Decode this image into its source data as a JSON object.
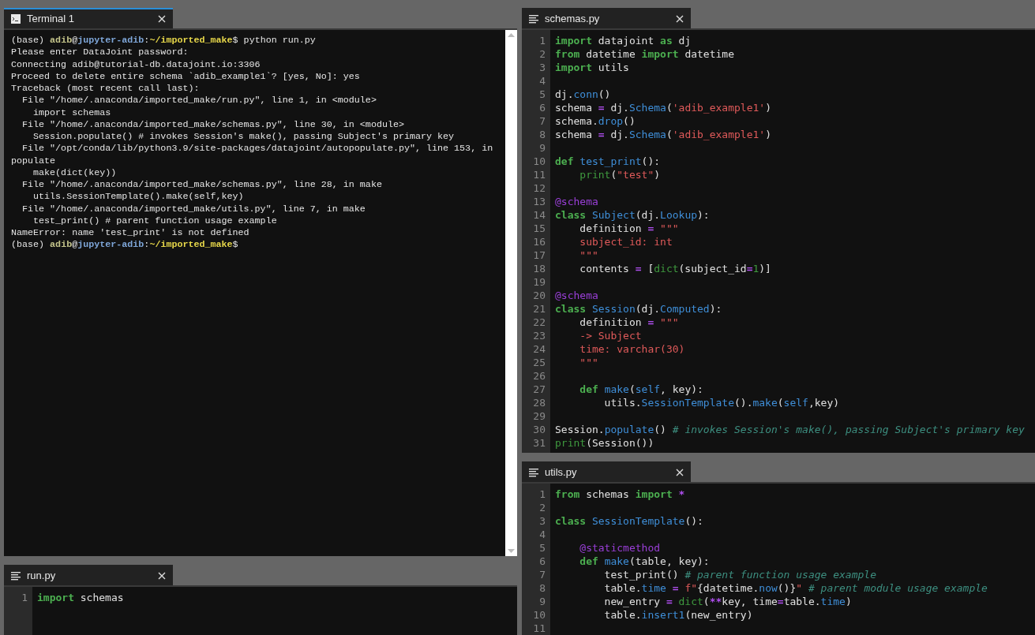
{
  "left": [
    {
      "kind": "terminal",
      "tab": {
        "label": "Terminal 1",
        "selected": true
      },
      "lines": [
        [
          {
            "kind": "plain",
            "text": "(base) "
          },
          {
            "kind": "user",
            "text": "adib"
          },
          {
            "kind": "plain",
            "text": "@"
          },
          {
            "kind": "host",
            "text": "jupyter-adib"
          },
          {
            "kind": "plain",
            "text": ":"
          },
          {
            "kind": "path",
            "text": "~/imported_make"
          },
          {
            "kind": "plain",
            "text": "$ python run.py"
          }
        ],
        [
          {
            "kind": "plain",
            "text": "Please enter DataJoint password:"
          }
        ],
        [
          {
            "kind": "plain",
            "text": "Connecting adib@tutorial-db.datajoint.io:3306"
          }
        ],
        [
          {
            "kind": "plain",
            "text": "Proceed to delete entire schema `adib_example1`? [yes, No]: yes"
          }
        ],
        [
          {
            "kind": "plain",
            "text": "Traceback (most recent call last):"
          }
        ],
        [
          {
            "kind": "plain",
            "text": "  File \"/home/.anaconda/imported_make/run.py\", line 1, in <module>"
          }
        ],
        [
          {
            "kind": "plain",
            "text": "    import schemas"
          }
        ],
        [
          {
            "kind": "plain",
            "text": "  File \"/home/.anaconda/imported_make/schemas.py\", line 30, in <module>"
          }
        ],
        [
          {
            "kind": "plain",
            "text": "    Session.populate() # invokes Session's make(), passing Subject's primary key"
          }
        ],
        [
          {
            "kind": "plain",
            "text": "  File \"/opt/conda/lib/python3.9/site-packages/datajoint/autopopulate.py\", line 153, in"
          }
        ],
        [
          {
            "kind": "plain",
            "text": "populate"
          }
        ],
        [
          {
            "kind": "plain",
            "text": "    make(dict(key))"
          }
        ],
        [
          {
            "kind": "plain",
            "text": "  File \"/home/.anaconda/imported_make/schemas.py\", line 28, in make"
          }
        ],
        [
          {
            "kind": "plain",
            "text": "    utils.SessionTemplate().make(self,key)"
          }
        ],
        [
          {
            "kind": "plain",
            "text": "  File \"/home/.anaconda/imported_make/utils.py\", line 7, in make"
          }
        ],
        [
          {
            "kind": "plain",
            "text": "    test_print() # parent function usage example"
          }
        ],
        [
          {
            "kind": "plain",
            "text": "NameError: name 'test_print' is not defined"
          }
        ],
        [
          {
            "kind": "plain",
            "text": "(base) "
          },
          {
            "kind": "user",
            "text": "adib"
          },
          {
            "kind": "plain",
            "text": "@"
          },
          {
            "kind": "host",
            "text": "jupyter-adib"
          },
          {
            "kind": "plain",
            "text": ":"
          },
          {
            "kind": "path",
            "text": "~/imported_make"
          },
          {
            "kind": "plain",
            "text": "$"
          }
        ]
      ]
    },
    {
      "kind": "editor",
      "tab": {
        "label": "run.py",
        "selected": false
      },
      "lines": [
        {
          "number": "1",
          "tokens": [
            {
              "kind": "kw",
              "text": "import"
            },
            {
              "kind": "plain",
              "text": " schemas"
            }
          ]
        }
      ]
    }
  ],
  "right": [
    {
      "kind": "editor",
      "tab": {
        "label": "schemas.py",
        "selected": false
      },
      "lines": [
        {
          "number": "1",
          "tokens": [
            {
              "kind": "kw",
              "text": "import"
            },
            {
              "kind": "plain",
              "text": " datajoint "
            },
            {
              "kind": "kw",
              "text": "as"
            },
            {
              "kind": "plain",
              "text": " dj"
            }
          ]
        },
        {
          "number": "2",
          "tokens": [
            {
              "kind": "kw",
              "text": "from"
            },
            {
              "kind": "plain",
              "text": " datetime "
            },
            {
              "kind": "kw",
              "text": "import"
            },
            {
              "kind": "plain",
              "text": " datetime"
            }
          ]
        },
        {
          "number": "3",
          "tokens": [
            {
              "kind": "kw",
              "text": "import"
            },
            {
              "kind": "plain",
              "text": " utils"
            }
          ]
        },
        {
          "number": "4"
        },
        {
          "number": "5",
          "tokens": [
            {
              "kind": "plain",
              "text": "dj."
            },
            {
              "kind": "fn",
              "text": "conn"
            },
            {
              "kind": "plain",
              "text": "()"
            }
          ]
        },
        {
          "number": "6",
          "tokens": [
            {
              "kind": "plain",
              "text": "schema "
            },
            {
              "kind": "op",
              "text": "="
            },
            {
              "kind": "plain",
              "text": " dj."
            },
            {
              "kind": "fn",
              "text": "Schema"
            },
            {
              "kind": "plain",
              "text": "("
            },
            {
              "kind": "str",
              "text": "'adib_example1'"
            },
            {
              "kind": "plain",
              "text": ")"
            }
          ]
        },
        {
          "number": "7",
          "tokens": [
            {
              "kind": "plain",
              "text": "schema."
            },
            {
              "kind": "fn",
              "text": "drop"
            },
            {
              "kind": "plain",
              "text": "()"
            }
          ]
        },
        {
          "number": "8",
          "tokens": [
            {
              "kind": "plain",
              "text": "schema "
            },
            {
              "kind": "op",
              "text": "="
            },
            {
              "kind": "plain",
              "text": " dj."
            },
            {
              "kind": "fn",
              "text": "Schema"
            },
            {
              "kind": "plain",
              "text": "("
            },
            {
              "kind": "str",
              "text": "'adib_example1'"
            },
            {
              "kind": "plain",
              "text": ")"
            }
          ]
        },
        {
          "number": "9"
        },
        {
          "number": "10",
          "tokens": [
            {
              "kind": "kw",
              "text": "def "
            },
            {
              "kind": "fn",
              "text": "test_print"
            },
            {
              "kind": "plain",
              "text": "():"
            }
          ]
        },
        {
          "number": "11",
          "tokens": [
            {
              "kind": "bi",
              "text": "    print"
            },
            {
              "kind": "plain",
              "text": "("
            },
            {
              "kind": "str",
              "text": "\"test\""
            },
            {
              "kind": "plain",
              "text": ")"
            }
          ]
        },
        {
          "number": "12"
        },
        {
          "number": "13",
          "tokens": [
            {
              "kind": "deco",
              "text": "@schema"
            }
          ]
        },
        {
          "number": "14",
          "tokens": [
            {
              "kind": "kw",
              "text": "class "
            },
            {
              "kind": "fn",
              "text": "Subject"
            },
            {
              "kind": "plain",
              "text": "(dj."
            },
            {
              "kind": "fn",
              "text": "Lookup"
            },
            {
              "kind": "plain",
              "text": "):"
            }
          ]
        },
        {
          "number": "15",
          "tokens": [
            {
              "kind": "plain",
              "text": "    definition "
            },
            {
              "kind": "op",
              "text": "="
            },
            {
              "kind": "str",
              "text": " \"\"\""
            }
          ]
        },
        {
          "number": "16",
          "tokens": [
            {
              "kind": "str",
              "text": "    subject_id: int"
            }
          ]
        },
        {
          "number": "17",
          "tokens": [
            {
              "kind": "str",
              "text": "    \"\"\""
            }
          ]
        },
        {
          "number": "18",
          "tokens": [
            {
              "kind": "plain",
              "text": "    contents "
            },
            {
              "kind": "op",
              "text": "="
            },
            {
              "kind": "plain",
              "text": " ["
            },
            {
              "kind": "bi",
              "text": "dict"
            },
            {
              "kind": "plain",
              "text": "(subject_id"
            },
            {
              "kind": "op",
              "text": "="
            },
            {
              "kind": "num",
              "text": "1"
            },
            {
              "kind": "plain",
              "text": ")]"
            }
          ]
        },
        {
          "number": "19"
        },
        {
          "number": "20",
          "tokens": [
            {
              "kind": "deco",
              "text": "@schema"
            }
          ]
        },
        {
          "number": "21",
          "tokens": [
            {
              "kind": "kw",
              "text": "class "
            },
            {
              "kind": "fn",
              "text": "Session"
            },
            {
              "kind": "plain",
              "text": "(dj."
            },
            {
              "kind": "fn",
              "text": "Computed"
            },
            {
              "kind": "plain",
              "text": "):"
            }
          ]
        },
        {
          "number": "22",
          "tokens": [
            {
              "kind": "plain",
              "text": "    definition "
            },
            {
              "kind": "op",
              "text": "="
            },
            {
              "kind": "str",
              "text": " \"\"\""
            }
          ]
        },
        {
          "number": "23",
          "tokens": [
            {
              "kind": "str",
              "text": "    -> Subject"
            }
          ]
        },
        {
          "number": "24",
          "tokens": [
            {
              "kind": "str",
              "text": "    time: varchar(30)"
            }
          ]
        },
        {
          "number": "25",
          "tokens": [
            {
              "kind": "str",
              "text": "    \"\"\""
            }
          ]
        },
        {
          "number": "26"
        },
        {
          "number": "27",
          "tokens": [
            {
              "kind": "kw",
              "text": "    def "
            },
            {
              "kind": "fn",
              "text": "make"
            },
            {
              "kind": "plain",
              "text": "("
            },
            {
              "kind": "fn",
              "text": "self"
            },
            {
              "kind": "plain",
              "text": ", key):"
            }
          ]
        },
        {
          "number": "28",
          "tokens": [
            {
              "kind": "plain",
              "text": "        utils."
            },
            {
              "kind": "fn",
              "text": "SessionTemplate"
            },
            {
              "kind": "plain",
              "text": "()."
            },
            {
              "kind": "fn",
              "text": "make"
            },
            {
              "kind": "plain",
              "text": "("
            },
            {
              "kind": "fn",
              "text": "self"
            },
            {
              "kind": "plain",
              "text": ",key)"
            }
          ]
        },
        {
          "number": "29"
        },
        {
          "number": "30",
          "tokens": [
            {
              "kind": "plain",
              "text": "Session."
            },
            {
              "kind": "fn",
              "text": "populate"
            },
            {
              "kind": "plain",
              "text": "() "
            },
            {
              "kind": "cm",
              "text": "# invokes Session's make(), passing Subject's primary key"
            }
          ]
        },
        {
          "number": "31",
          "tokens": [
            {
              "kind": "bi",
              "text": "print"
            },
            {
              "kind": "plain",
              "text": "(Session())"
            }
          ]
        }
      ]
    },
    {
      "kind": "editor",
      "tab": {
        "label": "utils.py",
        "selected": false
      },
      "lines": [
        {
          "number": "1",
          "tokens": [
            {
              "kind": "kw",
              "text": "from"
            },
            {
              "kind": "plain",
              "text": " schemas "
            },
            {
              "kind": "kw",
              "text": "import"
            },
            {
              "kind": "op",
              "text": " *"
            }
          ]
        },
        {
          "number": "2"
        },
        {
          "number": "3",
          "tokens": [
            {
              "kind": "kw",
              "text": "class "
            },
            {
              "kind": "fn",
              "text": "SessionTemplate"
            },
            {
              "kind": "plain",
              "text": "():"
            }
          ]
        },
        {
          "number": "4"
        },
        {
          "number": "5",
          "tokens": [
            {
              "kind": "deco",
              "text": "    @staticmethod"
            }
          ]
        },
        {
          "number": "6",
          "tokens": [
            {
              "kind": "kw",
              "text": "    def "
            },
            {
              "kind": "fn",
              "text": "make"
            },
            {
              "kind": "plain",
              "text": "(table, key):"
            }
          ]
        },
        {
          "number": "7",
          "tokens": [
            {
              "kind": "plain",
              "text": "        test_print() "
            },
            {
              "kind": "cm",
              "text": "# parent function usage example"
            }
          ]
        },
        {
          "number": "8",
          "tokens": [
            {
              "kind": "plain",
              "text": "        table."
            },
            {
              "kind": "fn",
              "text": "time"
            },
            {
              "kind": "op",
              "text": " = "
            },
            {
              "kind": "str",
              "text": "f\""
            },
            {
              "kind": "plain",
              "text": "{datetime."
            },
            {
              "kind": "fn",
              "text": "now"
            },
            {
              "kind": "plain",
              "text": "()}"
            },
            {
              "kind": "str",
              "text": "\""
            },
            {
              "kind": "cm",
              "text": " # parent module usage example"
            }
          ]
        },
        {
          "number": "9",
          "tokens": [
            {
              "kind": "plain",
              "text": "        new_entry "
            },
            {
              "kind": "op",
              "text": "="
            },
            {
              "kind": "bi",
              "text": " dict"
            },
            {
              "kind": "plain",
              "text": "("
            },
            {
              "kind": "op",
              "text": "**"
            },
            {
              "kind": "plain",
              "text": "key, time"
            },
            {
              "kind": "op",
              "text": "="
            },
            {
              "kind": "plain",
              "text": "table."
            },
            {
              "kind": "fn",
              "text": "time"
            },
            {
              "kind": "plain",
              "text": ")"
            }
          ]
        },
        {
          "number": "10",
          "tokens": [
            {
              "kind": "plain",
              "text": "        table."
            },
            {
              "kind": "fn",
              "text": "insert1"
            },
            {
              "kind": "plain",
              "text": "(new_entry)"
            }
          ]
        },
        {
          "number": "11"
        }
      ]
    }
  ]
}
